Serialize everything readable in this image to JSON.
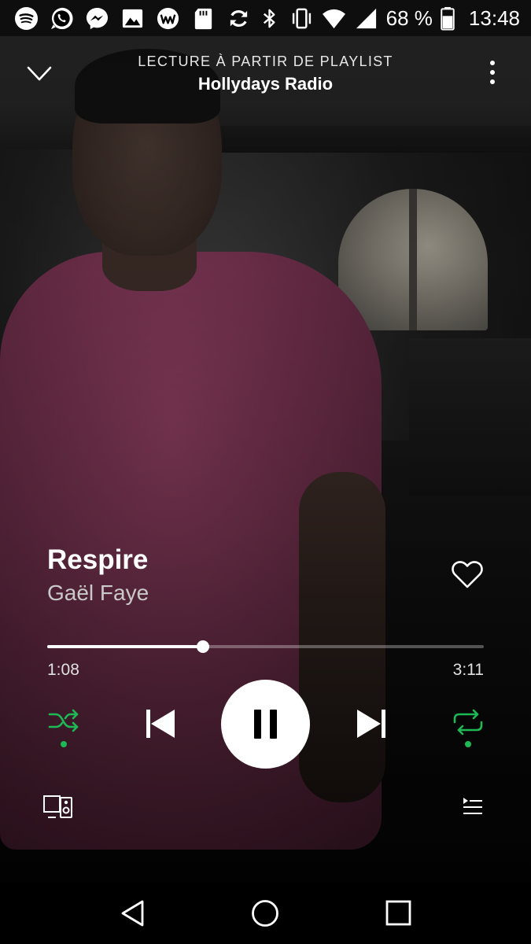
{
  "status_bar": {
    "left_icons": [
      "spotify-icon",
      "whatsapp-icon",
      "messenger-icon",
      "gallery-icon",
      "browser-icon",
      "sd-card-icon",
      "sync-icon"
    ],
    "right_icons": [
      "bluetooth-icon",
      "vibrate-icon",
      "wifi-icon",
      "signal-icon"
    ],
    "battery_text": "68 %",
    "battery_level": 0.68,
    "clock": "13:48"
  },
  "header": {
    "eyebrow": "LECTURE À PARTIR DE PLAYLIST",
    "title": "Hollydays Radio",
    "collapse_icon": "chevron-down-icon",
    "more_icon": "more-vertical-icon"
  },
  "track": {
    "title": "Respire",
    "artist": "Gaël Faye",
    "liked": false
  },
  "progress": {
    "elapsed": "1:08",
    "total": "3:11",
    "fraction": 0.356
  },
  "controls": {
    "shuffle_active": true,
    "repeat_active": true,
    "state": "playing",
    "accent_color": "#1DB954"
  },
  "bottom": {
    "devices_icon": "devices-icon",
    "queue_icon": "queue-icon"
  },
  "nav": {
    "back_icon": "nav-back-icon",
    "home_icon": "nav-home-icon",
    "recents_icon": "nav-recents-icon"
  }
}
